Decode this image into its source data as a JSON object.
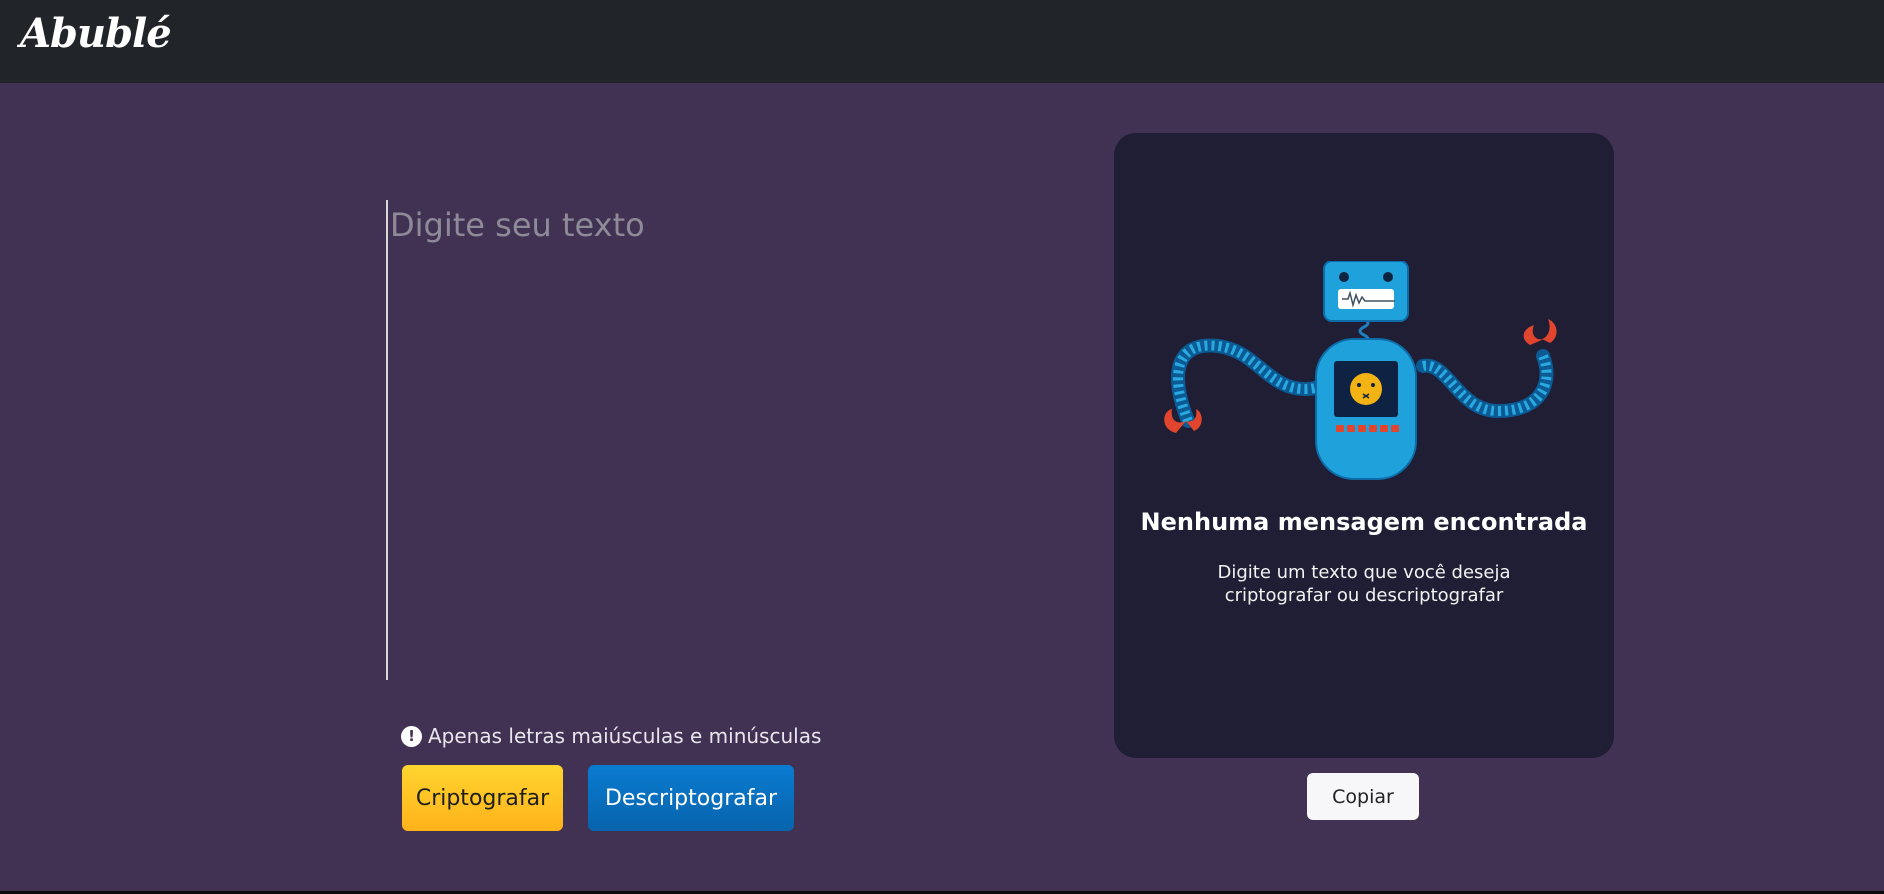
{
  "app": {
    "logo_text": "Abublé"
  },
  "input": {
    "placeholder": "Digite seu texto",
    "value": ""
  },
  "hint": {
    "icon": "exclamation-circle-icon",
    "text": "Apenas letras maiúsculas e minúsculas"
  },
  "actions": {
    "encrypt_label": "Criptografar",
    "decrypt_label": "Descriptografar"
  },
  "output": {
    "illustration": "robot-illustration",
    "title": "Nenhuma mensagem encontrada",
    "description": "Digite um texto que você deseja criptografar ou descriptografar",
    "copy_label": "Copiar"
  },
  "colors": {
    "header_bg": "#212429",
    "page_bg": "#413253",
    "panel_bg": "#1f1e34",
    "encrypt_button": "#ffc52a",
    "decrypt_button": "#0a70bf",
    "copy_button": "#f7f7f9"
  }
}
